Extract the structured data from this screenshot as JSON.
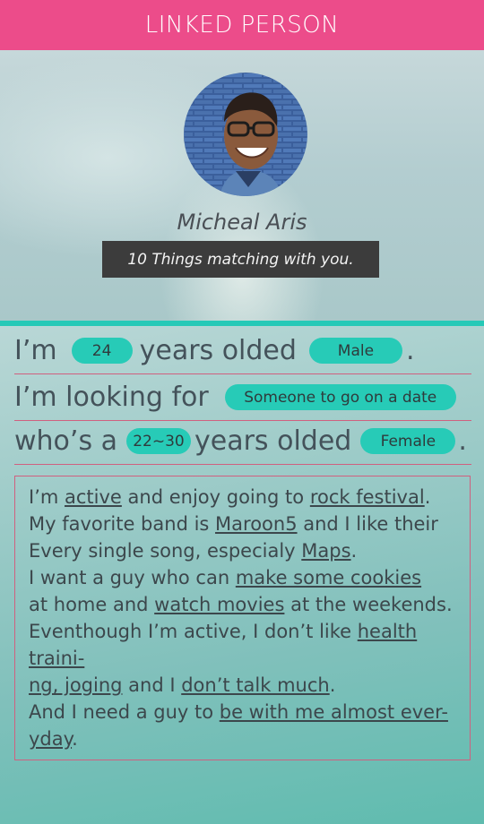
{
  "header": {
    "title": "LINKED PERSON"
  },
  "profile": {
    "name": "Micheal Aris",
    "match_text": "10 Things matching with you."
  },
  "row1": {
    "prefix": "I’m",
    "age": "24",
    "middle": "years olded",
    "gender": "Male",
    "suffix": "."
  },
  "row2": {
    "prefix": "I’m looking for",
    "intent": "Someone to go on a date"
  },
  "row3": {
    "prefix": "who’s a",
    "age_range": "22~30",
    "middle": "years olded",
    "gender": "Female",
    "suffix": "."
  },
  "bio": {
    "line1": {
      "a": "I’m ",
      "b": "active",
      "c": " and enjoy going to ",
      "d": "rock festival",
      "e": "."
    },
    "line2": {
      "a": "My favorite band is ",
      "b": "Maroon5",
      "c": " and I like their"
    },
    "line3": {
      "a": "Every single song, especialy ",
      "b": "Maps",
      "c": "."
    },
    "line4": {
      "a": "I want a guy who can ",
      "b": "make some cookies"
    },
    "line5": {
      "a": "at home and ",
      "b": "watch movies",
      "c": " at the weekends."
    },
    "line6": {
      "a": "Eventhough I’m active, I don’t like ",
      "b": "health traini-"
    },
    "line7": {
      "a": "ng, joging",
      "b": " and I ",
      "c": "don’t talk much",
      "d": "."
    },
    "line8": {
      "a": "And I need a guy to ",
      "b": "be with me almost ever-"
    },
    "line9": {
      "a": "yday",
      "b": "."
    }
  },
  "colors": {
    "header": "#ec4c8a",
    "accent": "#27cbb7",
    "divider": "#d0607f",
    "match_box": "#3c3c3c"
  },
  "icons": {
    "avatar": "profile-photo"
  }
}
